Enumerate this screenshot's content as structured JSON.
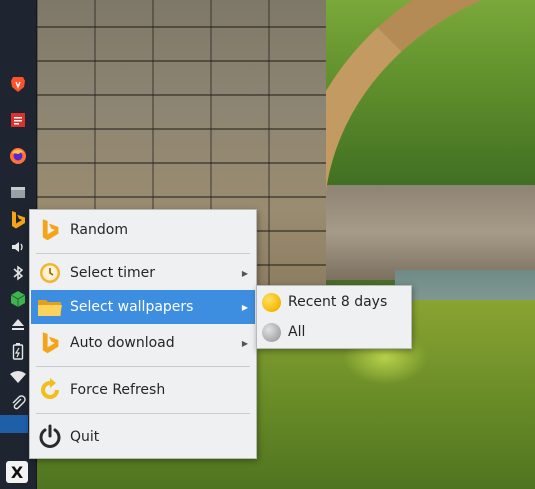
{
  "menu": {
    "items": [
      {
        "label": "Random",
        "icon": "bing-icon"
      },
      {
        "label": "Select timer",
        "icon": "clock-icon",
        "submenu": true
      },
      {
        "label": "Select wallpapers",
        "icon": "folder-icon",
        "submenu": true,
        "active": true
      },
      {
        "label": "Auto download",
        "icon": "bing-icon",
        "submenu": true
      },
      {
        "label": "Force Refresh",
        "icon": "refresh-icon"
      },
      {
        "label": "Quit",
        "icon": "power-icon"
      }
    ]
  },
  "submenu": {
    "items": [
      {
        "label": "Recent 8 days",
        "icon": "yellow-dot-icon",
        "color": "#f5b800"
      },
      {
        "label": "All",
        "icon": "gray-dot-icon",
        "color": "#a8a8a8"
      }
    ]
  },
  "panel": {
    "launcher_label": "X"
  },
  "colors": {
    "panel_bg": "#1f2530",
    "menu_bg": "#eff0f1",
    "highlight": "#3d8ee0",
    "bing": "#f4a418"
  }
}
